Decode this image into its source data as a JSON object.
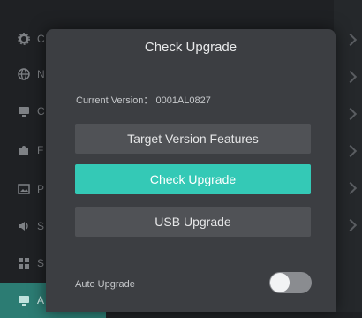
{
  "sidebar": {
    "items": [
      {
        "icon": "gear-icon",
        "label": "C"
      },
      {
        "icon": "globe-icon",
        "label": "N"
      },
      {
        "icon": "display-icon",
        "label": "C"
      },
      {
        "icon": "puzzle-icon",
        "label": "F"
      },
      {
        "icon": "image-icon",
        "label": "P"
      },
      {
        "icon": "speaker-icon",
        "label": "S"
      },
      {
        "icon": "grid-icon",
        "label": "S"
      },
      {
        "icon": "upgrade-icon",
        "label": "A"
      }
    ],
    "active_color": "#2c7c73"
  },
  "dialog": {
    "title": "Check Upgrade",
    "current_version": "Current Version： 0001AL0827",
    "buttons": {
      "target_features": "Target Version Features",
      "check_upgrade": "Check Upgrade",
      "usb_upgrade": "USB Upgrade"
    },
    "auto_upgrade": {
      "label": "Auto Upgrade",
      "enabled": false
    },
    "accent_color": "#34c9b6"
  }
}
